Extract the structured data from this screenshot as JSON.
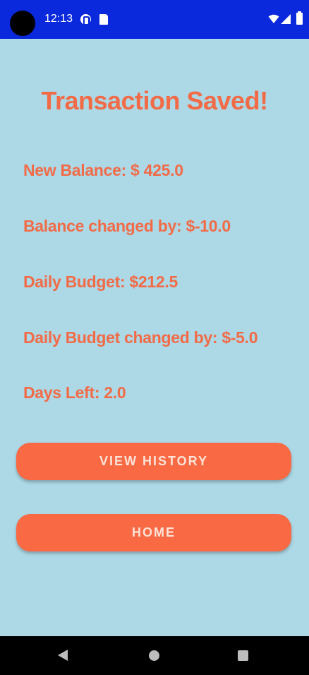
{
  "status_bar": {
    "time": "12:13",
    "icons": [
      "camera-cutout",
      "notification-p-icon",
      "sd-card-icon",
      "wifi-icon",
      "cell-signal-icon",
      "battery-icon"
    ],
    "background_color": "#0A28DC"
  },
  "screen": {
    "background_color": "#ADD8E6",
    "accent_color": "#F26B47",
    "title": "Transaction Saved!",
    "info": {
      "new_balance": "New Balance: $ 425.0",
      "balance_changed": "Balance changed by: $-10.0",
      "daily_budget": "Daily Budget: $212.5",
      "daily_budget_changed": "Daily Budget changed by: $-5.0",
      "days_left": "Days Left: 2.0"
    },
    "buttons": {
      "view_history": "VIEW HISTORY",
      "home": "HOME"
    }
  },
  "nav_bar": {
    "icons": [
      "back-icon",
      "home-icon",
      "recents-icon"
    ]
  }
}
